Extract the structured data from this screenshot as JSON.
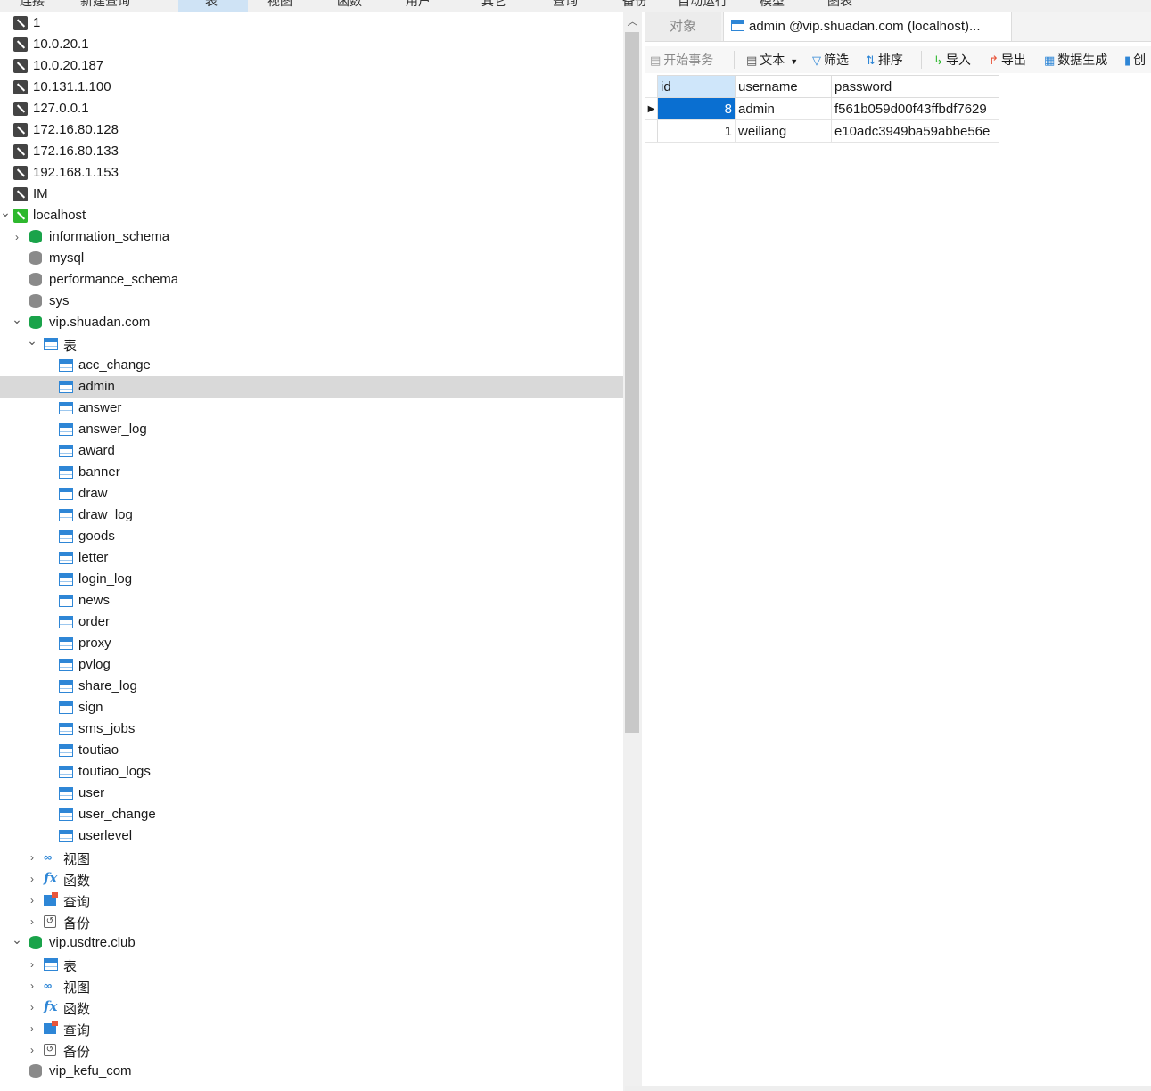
{
  "menu": {
    "items": [
      "连接",
      "新建查询",
      "表",
      "视图",
      "函数",
      "用户",
      "其它",
      "查询",
      "备份",
      "自动运行",
      "模型",
      "图表"
    ],
    "active_index": 2
  },
  "tree": {
    "connections_top": [
      "1",
      "10.0.20.1",
      "10.0.20.187",
      "10.131.1.100",
      "127.0.0.1",
      "172.16.80.128",
      "172.16.80.133",
      "192.168.1.153",
      "IM"
    ],
    "localhost": "localhost",
    "databases": [
      "information_schema",
      "mysql",
      "performance_schema",
      "sys"
    ],
    "db1": "vip.shuadan.com",
    "tables_folder": "表",
    "tables": [
      "acc_change",
      "admin",
      "answer",
      "answer_log",
      "award",
      "banner",
      "draw",
      "draw_log",
      "goods",
      "letter",
      "login_log",
      "news",
      "order",
      "proxy",
      "pvlog",
      "share_log",
      "sign",
      "sms_jobs",
      "toutiao",
      "toutiao_logs",
      "user",
      "user_change",
      "userlevel"
    ],
    "selected_table": "admin",
    "folders": [
      "视图",
      "函数",
      "查询",
      "备份"
    ],
    "db2": "vip.usdtre.club",
    "db2_folders": [
      "表",
      "视图",
      "函数",
      "查询",
      "备份"
    ],
    "db3": "vip_kefu_com"
  },
  "tabs": {
    "objects": "对象",
    "current": "admin @vip.shuadan.com (localhost)..."
  },
  "toolbar": {
    "begin_tx": "开始事务",
    "text": "文本",
    "filter": "筛选",
    "sort": "排序",
    "import": "导入",
    "export": "导出",
    "generate": "数据生成",
    "create_chart": "创"
  },
  "grid": {
    "columns": [
      "id",
      "username",
      "password"
    ],
    "rows": [
      {
        "id": "8",
        "username": "admin",
        "password": "f561b059d00f43ffbdf7629"
      },
      {
        "id": "1",
        "username": "weiliang",
        "password": "e10adc3949ba59abbe56e"
      }
    ]
  }
}
